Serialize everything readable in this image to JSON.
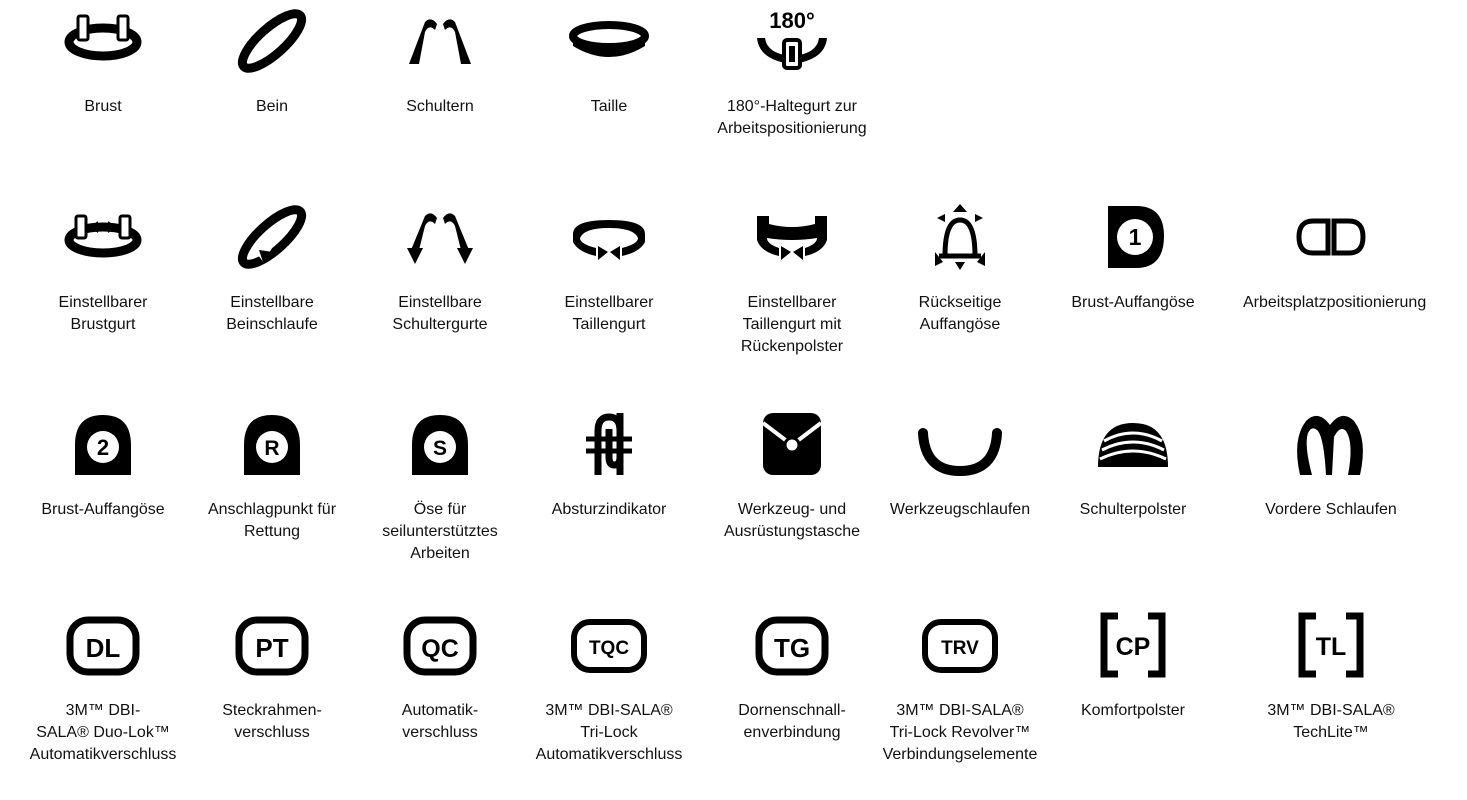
{
  "rows": [
    {
      "items": [
        {
          "icon": "chest-strap-icon",
          "label": "Brust"
        },
        {
          "icon": "leg-strap-icon",
          "label": "Bein"
        },
        {
          "icon": "shoulders-icon",
          "label": "Schultern"
        },
        {
          "icon": "waist-icon",
          "label": "Taille"
        },
        {
          "icon": "positioning-belt-180-icon",
          "icon_text": "180°",
          "label": "180°-Haltegurt zur\nArbeitspositionierung"
        }
      ]
    },
    {
      "items": [
        {
          "icon": "adjustable-chest-strap-icon",
          "label": "Einstellbarer\nBrustgurt"
        },
        {
          "icon": "adjustable-leg-loop-icon",
          "label": "Einstellbare\nBeinschlaufe"
        },
        {
          "icon": "adjustable-shoulder-straps-icon",
          "label": "Einstellbare\nSchultergurte"
        },
        {
          "icon": "adjustable-waist-belt-icon",
          "label": "Einstellbarer\nTaillengurt"
        },
        {
          "icon": "adjustable-waist-belt-back-pad-icon",
          "label": "Einstellbarer\nTaillengurt mit\nRückenpolster"
        },
        {
          "icon": "rear-d-ring-icon",
          "label": "Rückseitige\nAuffangöse"
        },
        {
          "icon": "chest-d-ring-1-icon",
          "icon_text": "1",
          "label": "Brust-Auffangöse"
        },
        {
          "icon": "work-positioning-icon",
          "label": "Arbeitsplatzpositionierung"
        }
      ]
    },
    {
      "items": [
        {
          "icon": "chest-d-ring-2-icon",
          "icon_text": "2",
          "label": "Brust-Auffangöse"
        },
        {
          "icon": "rescue-anchor-r-icon",
          "icon_text": "R",
          "label": "Anschlagpunkt für\nRettung"
        },
        {
          "icon": "rope-access-s-icon",
          "icon_text": "S",
          "label": "Öse für\nseilunterstütztes\nArbeiten"
        },
        {
          "icon": "fall-indicator-icon",
          "label": "Absturzindikator"
        },
        {
          "icon": "tool-pouch-icon",
          "label": "Werkzeug- und\nAusrüstungstasche"
        },
        {
          "icon": "tool-loops-icon",
          "label": "Werkzeugschlaufen"
        },
        {
          "icon": "shoulder-pads-icon",
          "label": "Schulterpolster"
        },
        {
          "icon": "front-loops-icon",
          "label": "Vordere Schlaufen"
        }
      ]
    },
    {
      "items": [
        {
          "icon": "duo-lok-dl-icon",
          "icon_text": "DL",
          "label": "3M™ DBI-\nSALA® Duo-Lok™\nAutomatikverschluss"
        },
        {
          "icon": "pass-thru-pt-icon",
          "icon_text": "PT",
          "label": "Steckrahmen-\nverschluss"
        },
        {
          "icon": "quick-connect-qc-icon",
          "icon_text": "QC",
          "label": "Automatik-\nverschluss"
        },
        {
          "icon": "tri-lock-tqc-icon",
          "icon_text": "TQC",
          "label": "3M™ DBI-SALA®\nTri-Lock\nAutomatikverschluss"
        },
        {
          "icon": "tongue-buckle-tg-icon",
          "icon_text": "TG",
          "label": "Dornenschnall-\nenverbindung"
        },
        {
          "icon": "tri-lock-revolver-trv-icon",
          "icon_text": "TRV",
          "label": "3M™ DBI-SALA®\nTri-Lock Revolver™\nVerbindungselemente"
        },
        {
          "icon": "comfort-padding-cp-icon",
          "icon_text": "CP",
          "label": "Komfortpolster"
        },
        {
          "icon": "techlite-tl-icon",
          "icon_text": "TL",
          "label": "3M™ DBI-SALA®\nTechLite™"
        }
      ]
    }
  ]
}
